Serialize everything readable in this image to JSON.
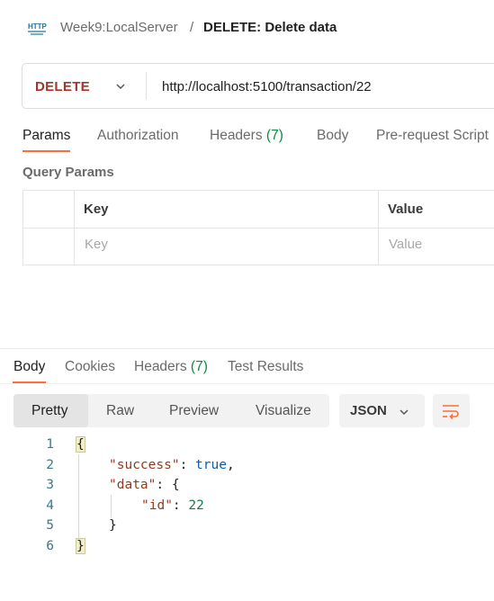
{
  "breadcrumb": {
    "http_badge": "HTTP",
    "parent": "Week9:LocalServer",
    "separator": "/",
    "current": "DELETE: Delete data"
  },
  "request": {
    "method": "DELETE",
    "url": "http://localhost:5100/transaction/22"
  },
  "request_tabs": [
    {
      "label": "Params",
      "active": true
    },
    {
      "label": "Authorization"
    },
    {
      "label": "Headers",
      "count": "(7)"
    },
    {
      "label": "Body"
    },
    {
      "label": "Pre-request Script"
    }
  ],
  "query_params": {
    "title": "Query Params",
    "columns": [
      "Key",
      "Value"
    ],
    "placeholders": [
      "Key",
      "Value"
    ]
  },
  "response_tabs": [
    {
      "label": "Body",
      "active": true
    },
    {
      "label": "Cookies"
    },
    {
      "label": "Headers",
      "count": "(7)"
    },
    {
      "label": "Test Results"
    }
  ],
  "view_modes": [
    {
      "label": "Pretty",
      "active": true
    },
    {
      "label": "Raw"
    },
    {
      "label": "Preview"
    },
    {
      "label": "Visualize"
    }
  ],
  "format": "JSON",
  "response_body": {
    "line_numbers": [
      "1",
      "2",
      "3",
      "4",
      "5",
      "6"
    ],
    "open_brace": "{",
    "success_key": "\"success\"",
    "success_value": "true",
    "data_key": "\"data\"",
    "id_key": "\"id\"",
    "id_value": "22",
    "inner_open": "{",
    "inner_close": "}",
    "close_brace": "}",
    "colon": ":",
    "comma": ","
  },
  "colors": {
    "accent": "#ff6c37",
    "method": "#a4352a",
    "count": "#0c8a3e"
  },
  "icons": [
    "http-icon",
    "chevron-down-icon",
    "wrap-lines-icon"
  ]
}
